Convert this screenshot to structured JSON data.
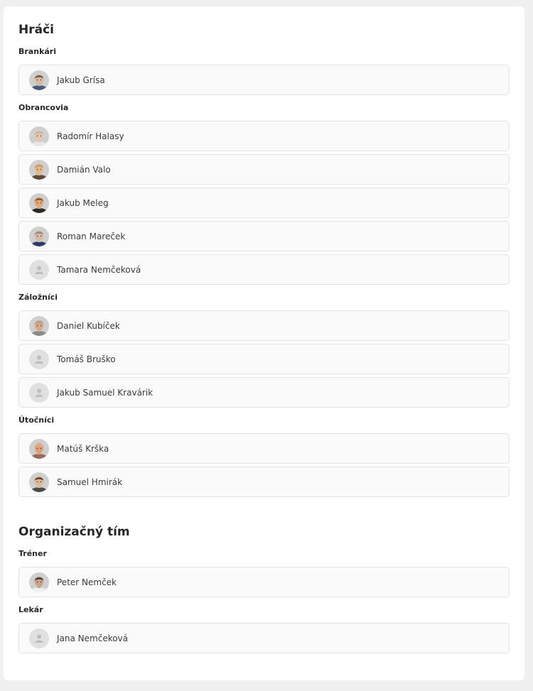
{
  "sections": [
    {
      "title": "Hráči",
      "groups": [
        {
          "title": "Brankári",
          "members": [
            {
              "name": "Jakub Grísa",
              "photo": true,
              "skin": "#d9b8a0",
              "hair": "#6b5546",
              "shirt": "#4a5a7a"
            }
          ]
        },
        {
          "title": "Obrancovia",
          "members": [
            {
              "name": "Radomír Halasy",
              "photo": true,
              "skin": "#e4c7b2",
              "hair": "#c9b49c",
              "shirt": "#e8e8e8"
            },
            {
              "name": "Damián Valo",
              "photo": true,
              "skin": "#e3b98f",
              "hair": "#c99a55",
              "shirt": "#5e4a3a"
            },
            {
              "name": "Jakub Meleg",
              "photo": true,
              "skin": "#e0a878",
              "hair": "#8a5a2b",
              "shirt": "#2a2a2a"
            },
            {
              "name": "Roman Mareček",
              "photo": true,
              "skin": "#d8b9a6",
              "hair": "#9c8676",
              "shirt": "#2b3a6b"
            },
            {
              "name": "Tamara Nemčeková",
              "photo": false
            }
          ]
        },
        {
          "title": "Záložníci",
          "members": [
            {
              "name": "Daniel Kubíček",
              "photo": true,
              "skin": "#d6a98a",
              "hair": "#b0a090",
              "shirt": "#8a8a8a"
            },
            {
              "name": "Tomáš Bruško",
              "photo": false
            },
            {
              "name": "Jakub Samuel Kravárik",
              "photo": false
            }
          ]
        },
        {
          "title": "Útočníci",
          "members": [
            {
              "name": "Matúš Krška",
              "photo": true,
              "skin": "#e0a07a",
              "hair": "#d9b28a",
              "shirt": "#9a6a5a"
            },
            {
              "name": "Samuel Hmirák",
              "photo": true,
              "skin": "#ddb99a",
              "hair": "#5a4030",
              "shirt": "#4a4a4a"
            }
          ]
        }
      ]
    },
    {
      "title": "Organizačný tím",
      "groups": [
        {
          "title": "Tréner",
          "members": [
            {
              "name": "Peter Nemček",
              "photo": true,
              "skin": "#c9a48a",
              "hair": "#3a3a3a",
              "shirt": "#f0f0f0"
            }
          ]
        },
        {
          "title": "Lekár",
          "members": [
            {
              "name": "Jana Nemčeková",
              "photo": false
            }
          ]
        }
      ]
    }
  ]
}
